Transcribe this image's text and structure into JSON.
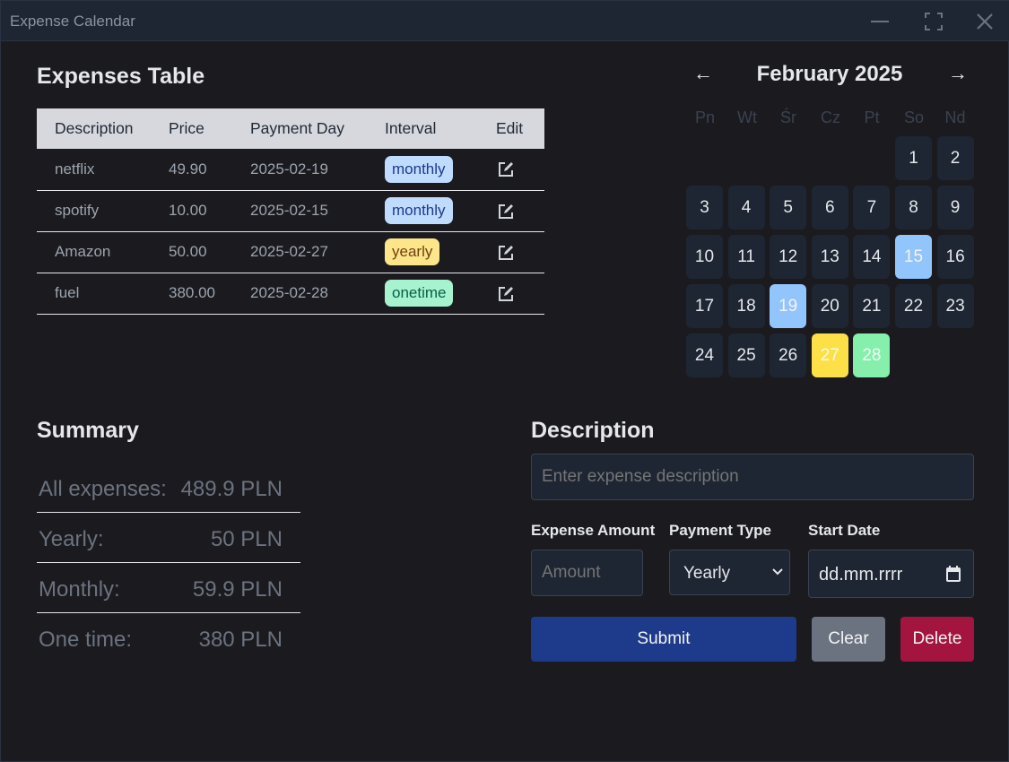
{
  "window": {
    "title": "Expense Calendar"
  },
  "table": {
    "title": "Expenses Table",
    "headers": [
      "Description",
      "Price",
      "Payment Day",
      "Interval",
      "Edit"
    ],
    "rows": [
      {
        "description": "netflix",
        "price": "49.90",
        "day": "2025-02-19",
        "interval": "monthly"
      },
      {
        "description": "spotify",
        "price": "10.00",
        "day": "2025-02-15",
        "interval": "monthly"
      },
      {
        "description": "Amazon",
        "price": "50.00",
        "day": "2025-02-27",
        "interval": "yearly"
      },
      {
        "description": "fuel",
        "price": "380.00",
        "day": "2025-02-28",
        "interval": "onetime"
      }
    ]
  },
  "calendar": {
    "prev": "←",
    "next": "→",
    "title": "February 2025",
    "weekdays": [
      "Pn",
      "Wt",
      "Śr",
      "Cz",
      "Pt",
      "So",
      "Nd"
    ],
    "days": [
      "1",
      "2",
      "3",
      "4",
      "5",
      "6",
      "7",
      "8",
      "9",
      "10",
      "11",
      "12",
      "13",
      "14",
      "15",
      "16",
      "17",
      "18",
      "19",
      "20",
      "21",
      "22",
      "23",
      "24",
      "25",
      "26",
      "27",
      "28"
    ],
    "highlights": {
      "15": "blue",
      "19": "blue",
      "27": "yellow",
      "28": "green"
    }
  },
  "summary": {
    "title": "Summary",
    "rows": [
      {
        "label": "All expenses:",
        "value": "489.9 PLN"
      },
      {
        "label": "Yearly:",
        "value": "50 PLN"
      },
      {
        "label": "Monthly:",
        "value": "59.9 PLN"
      },
      {
        "label": "One time:",
        "value": "380 PLN"
      }
    ]
  },
  "form": {
    "description_title": "Description",
    "description_placeholder": "Enter expense description",
    "amount_label": "Expense Amount",
    "amount_placeholder": "Amount",
    "type_label": "Payment Type",
    "type_value": "Yearly",
    "date_label": "Start Date",
    "date_placeholder": "dd.mm.rrrr",
    "submit": "Submit",
    "clear": "Clear",
    "delete": "Delete"
  },
  "colors": {
    "monthly": "#bfdbfe",
    "yearly": "#fde68a",
    "onetime": "#a7f3d0",
    "submit": "#1e3a8a",
    "delete": "#a3153f"
  }
}
